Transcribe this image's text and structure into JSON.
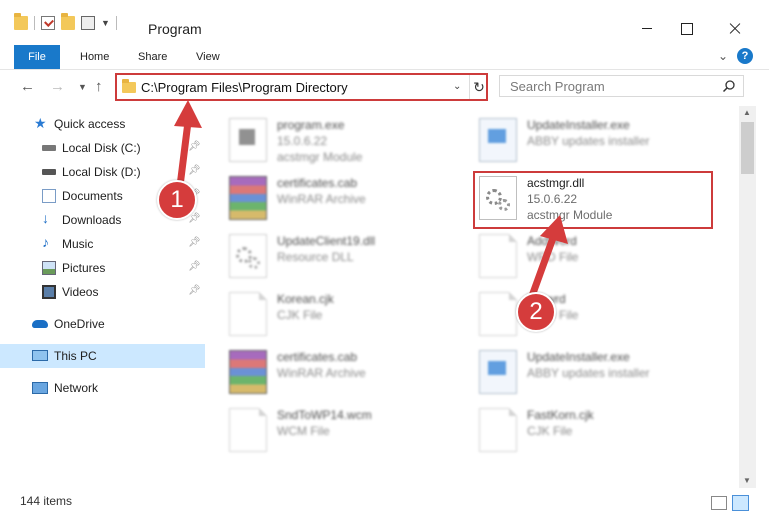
{
  "window": {
    "title": "Program",
    "minimize_icon": "minimize-icon",
    "maximize_icon": "maximize-icon",
    "close_icon": "close-icon"
  },
  "ribbon": {
    "tabs": [
      {
        "label": "File"
      },
      {
        "label": "Home"
      },
      {
        "label": "Share"
      },
      {
        "label": "View"
      }
    ],
    "help": "?"
  },
  "nav": {
    "address": "C:\\Program Files\\Program Directory",
    "search_placeholder": "Search Program"
  },
  "sidebar": {
    "items": [
      {
        "label": "Quick access",
        "icon": "star-icon"
      },
      {
        "label": "Local Disk (C:)",
        "icon": "drive-icon"
      },
      {
        "label": "Local Disk (D:)",
        "icon": "drive-icon"
      },
      {
        "label": "Documents",
        "icon": "documents-icon"
      },
      {
        "label": "Downloads",
        "icon": "download-icon"
      },
      {
        "label": "Music",
        "icon": "music-icon"
      },
      {
        "label": "Pictures",
        "icon": "pictures-icon"
      },
      {
        "label": "Videos",
        "icon": "videos-icon"
      },
      {
        "label": "OneDrive",
        "icon": "cloud-icon"
      },
      {
        "label": "This PC",
        "icon": "computer-icon"
      },
      {
        "label": "Network",
        "icon": "network-icon"
      }
    ]
  },
  "files": [
    {
      "name": "program.exe",
      "line2": "15.0.6.22",
      "line3": "acstmgr Module",
      "icon": "exe-icon"
    },
    {
      "name": "UpdateInstaller.exe",
      "line2": "ABBY updates installer",
      "line3": "",
      "icon": "setup-icon"
    },
    {
      "name": "certificates.cab",
      "line2": "WinRAR Archive",
      "line3": "",
      "icon": "archive-icon"
    },
    {
      "name": "acstmgr.dll",
      "line2": "15.0.6.22",
      "line3": "acstmgr Module",
      "icon": "dll-gear-icon"
    },
    {
      "name": "UpdateClient19.dll",
      "line2": "Resource DLL",
      "line3": "",
      "icon": "dll-gear-icon"
    },
    {
      "name": "AddWord",
      "line2": "WRD File",
      "line3": "",
      "icon": "blank-file-icon"
    },
    {
      "name": "Korean.cjk",
      "line2": "CJK File",
      "line3": "",
      "icon": "blank-file-icon"
    },
    {
      "name": "Ipc.wrd",
      "line2": "WRD File",
      "line3": "",
      "icon": "blank-file-icon"
    },
    {
      "name": "certificates.cab",
      "line2": "WinRAR Archive",
      "line3": "",
      "icon": "archive-icon"
    },
    {
      "name": "UpdateInstaller.exe",
      "line2": "ABBY updates installer",
      "line3": "",
      "icon": "setup-icon"
    },
    {
      "name": "SndToWP14.wcm",
      "line2": "WCM File",
      "line3": "",
      "icon": "blank-file-icon"
    },
    {
      "name": "FastKorn.cjk",
      "line2": "CJK File",
      "line3": "",
      "icon": "blank-file-icon"
    }
  ],
  "callouts": [
    "1",
    "2"
  ],
  "status": {
    "count": "144 items"
  },
  "colors": {
    "accent": "#1979ca",
    "highlight": "#cd3b3b",
    "selected": "#cce8ff"
  }
}
